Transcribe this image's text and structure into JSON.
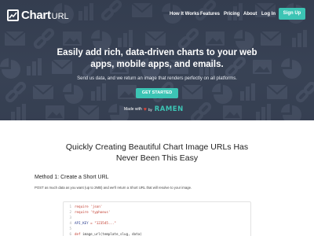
{
  "brand": {
    "name": "Chart",
    "suffix": "URL"
  },
  "nav": {
    "items": [
      "How It Works",
      "Features",
      "Pricing",
      "About",
      "Log In"
    ],
    "signup": "Sign Up"
  },
  "hero": {
    "headline_line1": "Easily add rich, data-driven charts to your web",
    "headline_line2": "apps, mobile apps, and emails.",
    "subtext": "Send us data, and we return an image that renders perfectly on all platforms.",
    "cta": "GET STARTED",
    "made_with": "Made with",
    "by": "by",
    "ramen": "RAMEN",
    "pattern_icons": [
      "envelope-icon",
      "pie-chart-icon",
      "link-icon",
      "bar-chart-icon",
      "image-icon"
    ]
  },
  "content": {
    "title_line1": "Quickly Creating Beautiful Chart Image URLs Has",
    "title_line2": "Never Been This Easy",
    "method_title": "Method 1: Create a Short URL",
    "method_desc": "POST as much data as you want (up to 2MB) and we'll return a Short URL that will resolve to your image."
  },
  "code": {
    "lines": [
      {
        "n": "1",
        "kw": "require",
        "rest": " 'json'"
      },
      {
        "n": "2",
        "kw": "require",
        "rest": " 'typhoeus'"
      },
      {
        "n": "3",
        "kw": "",
        "rest": ""
      },
      {
        "n": "4",
        "kw": "API_KEY",
        "rest": " = \"123545...\""
      },
      {
        "n": "5",
        "kw": "",
        "rest": ""
      },
      {
        "n": "6",
        "kw": "def",
        "rest": " image_url(template_slug, data)"
      }
    ]
  },
  "colors": {
    "hero_bg": "#3a4457",
    "accent": "#3cc4b4",
    "heart": "#e0453a"
  }
}
